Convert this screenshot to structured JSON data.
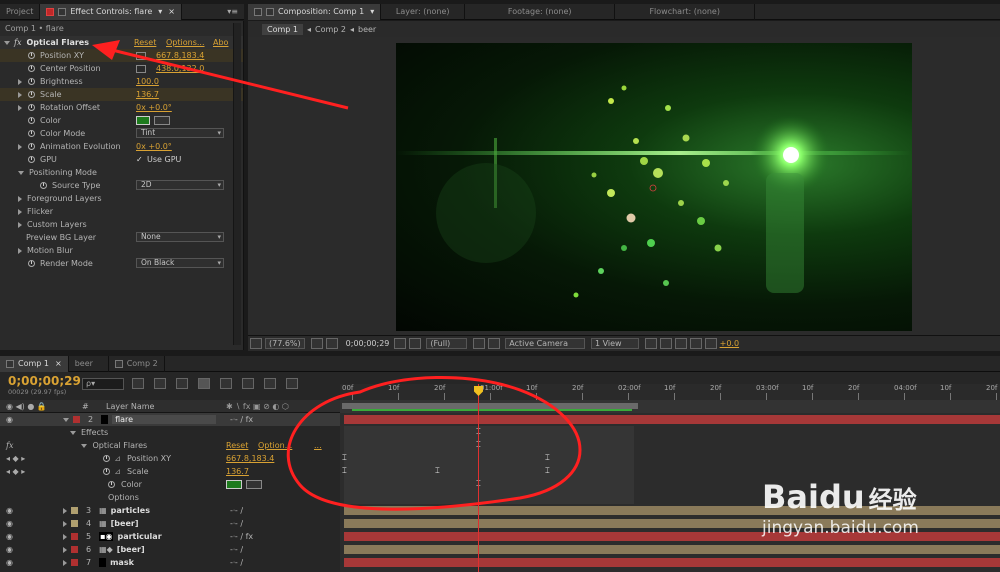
{
  "top_tabs": {
    "project": "Project",
    "effect_controls": "Effect Controls: flare",
    "composition": "Composition: Comp 1",
    "layer": "Layer: (none)",
    "footage": "Footage: (none)",
    "flowchart": "Flowchart: (none)"
  },
  "effect_controls": {
    "breadcrumb": "Comp 1 • flare",
    "effect_name": "Optical Flares",
    "reset": "Reset",
    "options": "Options...",
    "about": "Abo",
    "properties": [
      {
        "label": "Position XY",
        "value": "667.8,183.4"
      },
      {
        "label": "Center Position",
        "value": "438.0,132.0"
      },
      {
        "label": "Brightness",
        "value": "100.0"
      },
      {
        "label": "Scale",
        "value": "136.7"
      },
      {
        "label": "Rotation Offset",
        "value": "0x +0.0°"
      },
      {
        "label": "Color",
        "value": ""
      },
      {
        "label": "Color Mode",
        "value": "Tint"
      },
      {
        "label": "Animation Evolution",
        "value": "0x +0.0°"
      },
      {
        "label": "GPU",
        "value": "Use GPU"
      },
      {
        "label": "Positioning Mode",
        "value": ""
      },
      {
        "label": "Source Type",
        "value": "2D"
      },
      {
        "label": "Foreground Layers",
        "value": ""
      },
      {
        "label": "Flicker",
        "value": ""
      },
      {
        "label": "Custom Layers",
        "value": ""
      },
      {
        "label": "Preview BG Layer",
        "value": "None"
      },
      {
        "label": "Motion Blur",
        "value": ""
      },
      {
        "label": "Render Mode",
        "value": "On Black"
      }
    ]
  },
  "composition": {
    "breadcrumbs": [
      "Comp 1",
      "Comp 2",
      "beer"
    ],
    "zoom": "(77.6%)",
    "timecode": "0;00;00;29",
    "resolution": "(Full)",
    "camera": "Active Camera",
    "view": "1 View",
    "exposure": "+0.0"
  },
  "timeline": {
    "tabs": [
      "Comp 1",
      "beer",
      "Comp 2"
    ],
    "timecode": "0;00;00;29",
    "fps": "00029 (29.97 fps)",
    "search_placeholder": "ρ▾",
    "layer_name_header": "Layer Name",
    "hash_header": "#",
    "ruler": [
      "00f",
      "10f",
      "20f",
      "01:00f",
      "10f",
      "20f",
      "02:00f",
      "10f",
      "20f",
      "03:00f",
      "10f",
      "20f",
      "04:00f",
      "10f",
      "20f"
    ],
    "layers": [
      {
        "num": "2",
        "name": "flare"
      },
      {
        "num": "3",
        "name": "particles"
      },
      {
        "num": "4",
        "name": "[beer]"
      },
      {
        "num": "5",
        "name": "particular"
      },
      {
        "num": "6",
        "name": "[beer]"
      },
      {
        "num": "7",
        "name": "mask"
      }
    ],
    "sub": {
      "effects": "Effects",
      "optical_flares": "Optical Flares",
      "reset": "Reset",
      "options": "Option...",
      "dots": "...",
      "position_xy": "Position XY",
      "position_val": "667.8,183.4",
      "scale": "Scale",
      "scale_val": "136.7",
      "color": "Color",
      "options_row": "Options"
    }
  },
  "watermark": {
    "brand": "Baidu",
    "brand_cn": "经验",
    "url": "jingyan.baidu.com"
  },
  "colors": {
    "accent": "#d9a233",
    "flare_green": "#2b7a2b",
    "layer_red": "#a73838",
    "annotation": "#ff2020"
  }
}
